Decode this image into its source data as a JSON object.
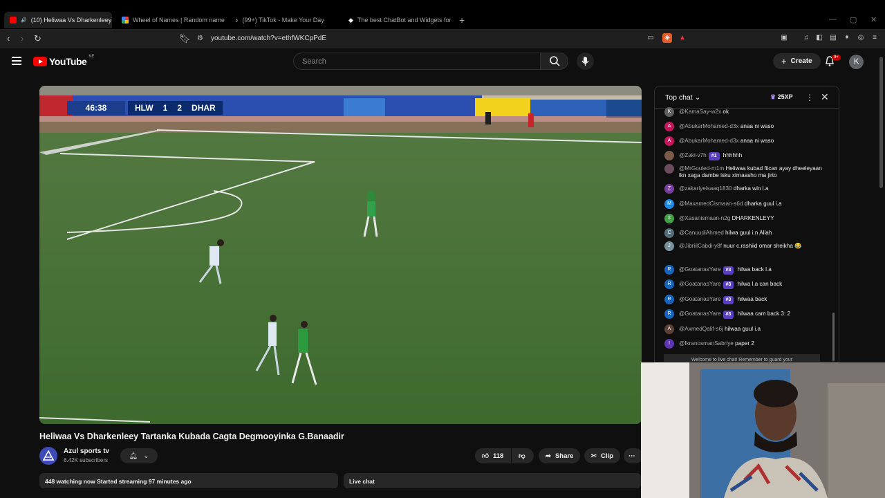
{
  "tabs": [
    {
      "title": "(10) Heliwaa Vs Dharkenleey",
      "favicon_color": "#ff0000"
    },
    {
      "title": "Wheel of Names | Random name picker",
      "favicon_color": "#4285f4"
    },
    {
      "title": "(99+) TikTok - Make Your Day",
      "favicon_color": "#ffffff"
    },
    {
      "title": "The best ChatBot and Widgets for Kick",
      "favicon_color": "#ffffff"
    }
  ],
  "address_bar": {
    "url": "youtube.com/watch?v=ethfWKCpPdE"
  },
  "youtube": {
    "logo_text": "YouTube",
    "country_code": "KE",
    "search_placeholder": "Search",
    "create_label": "Create",
    "notification_badge": "9+",
    "avatar_initial": "K"
  },
  "scoreboard": {
    "clock": "46:38",
    "home": "HLW",
    "home_score": "1",
    "away_score": "2",
    "away": "DHAR"
  },
  "video": {
    "title": "Heliwaa Vs Dharkenleey Tartanka Kubada Cagta Degmooyinka G.Banaadir",
    "channel_name": "Azul sports tv",
    "subscribers": "6.42K subscribers",
    "likes": "118",
    "share_label": "Share",
    "clip_label": "Clip",
    "watching": "448 watching now",
    "started": "Started streaming 97 minutes ago",
    "live_chat_label": "Live chat"
  },
  "chat": {
    "mode_label": "Top chat",
    "xp_label": "25XP",
    "welcome_text": "Welcome to live chat! Remember to guard your",
    "messages": [
      {
        "initial": "K",
        "color": "#5f5f5f",
        "author": "@KamaSay-w2x",
        "badge": "",
        "text": "ok"
      },
      {
        "initial": "A",
        "color": "#c2185b",
        "author": "@AbukarMohamed-d3x",
        "badge": "",
        "text": "anaa ni waso"
      },
      {
        "initial": "A",
        "color": "#c2185b",
        "author": "@AbukarMohamed-d3x",
        "badge": "",
        "text": "anaa ni waso"
      },
      {
        "initial": "",
        "color": "#7a5a48",
        "author": "@Zaki-v7h",
        "badge": "#1",
        "text": "hhhhhh"
      },
      {
        "initial": "",
        "color": "#6b4c5c",
        "author": "@MrGouled-m1m",
        "badge": "",
        "text": "Heliwaa kubad fiican ayay dheeleyaan lkn xaga dambe isku xirnaasho ma jirto"
      },
      {
        "initial": "Z",
        "color": "#7b3fa0",
        "author": "@zakariyeisaaq1830",
        "badge": "",
        "text": "dharka win l.a"
      },
      {
        "initial": "M",
        "color": "#1e88e5",
        "author": "@MaxamedCismaan-s6d",
        "badge": "",
        "text": "dharka guul i.a"
      },
      {
        "initial": "X",
        "color": "#43a047",
        "author": "@Xasanismaan-n2g",
        "badge": "",
        "text": "DHARKENLEYY"
      },
      {
        "initial": "C",
        "color": "#546e7a",
        "author": "@CanuudiAhmed",
        "badge": "",
        "text": "hilwa guul i.n Allah"
      },
      {
        "initial": "J",
        "color": "#78909c",
        "author": "@JibriilCabdi-y8f",
        "badge": "",
        "text": "nuur c.rashiid omar sheikha 😂"
      },
      {
        "initial": "R",
        "color": "#1565c0",
        "author": "@GoatanasYare",
        "badge": "#3",
        "text": "hilwa back l.a"
      },
      {
        "initial": "R",
        "color": "#1565c0",
        "author": "@GoatanasYare",
        "badge": "#3",
        "text": "hilwa l.a can back"
      },
      {
        "initial": "R",
        "color": "#1565c0",
        "author": "@GoatanasYare",
        "badge": "#3",
        "text": "hilwaa back"
      },
      {
        "initial": "R",
        "color": "#1565c0",
        "author": "@GoatanasYare",
        "badge": "#3",
        "text": "hilwaa cam back 3: 2"
      },
      {
        "initial": "A",
        "color": "#5d4037",
        "author": "@AxmedQalif-s6j",
        "badge": "",
        "text": "hilwaa guul i.a"
      },
      {
        "initial": "I",
        "color": "#5e35b1",
        "author": "@IkranosmanSabriye",
        "badge": "",
        "text": "paper 2"
      }
    ]
  }
}
